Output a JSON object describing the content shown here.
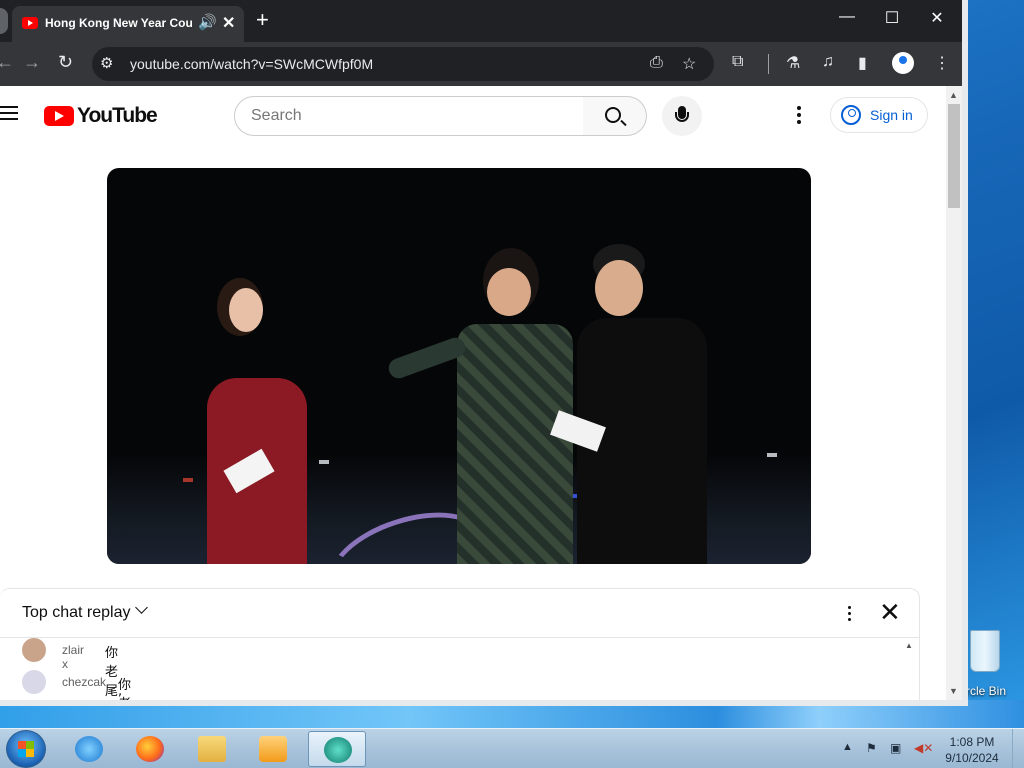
{
  "browser": {
    "tab_title": "Hong Kong New Year Cour",
    "tab_audio_glyph": "🔊",
    "tab_close_glyph": "✕",
    "new_tab_glyph": "+",
    "url": "youtube.com/watch?v=SWcMCWfpf0M",
    "window_controls": [
      "—",
      "☐",
      "✕"
    ]
  },
  "youtube": {
    "logo_text": "YouTube",
    "search_placeholder": "Search",
    "sign_in_label": "Sign in"
  },
  "chat": {
    "header": "Top chat replay",
    "messages": [
      {
        "author": "zlair x",
        "text": "你老尾,煙花呢",
        "avatar_color": "#c9a48a"
      },
      {
        "author": "chezcak",
        "text": "你老尾,煙花呢",
        "avatar_color": "#d8d8e8"
      }
    ]
  },
  "desktop": {
    "recycle_bin_label": "rcle Bin"
  },
  "taskbar": {
    "apps": [
      "internet-explorer",
      "firefox",
      "windows-explorer",
      "media-player",
      "active-app"
    ],
    "time": "1:08 PM",
    "date": "9/10/2024"
  },
  "colors": {
    "youtube_red": "#ff0000",
    "link_blue": "#065fd4",
    "chrome_dark": "#35363a"
  }
}
